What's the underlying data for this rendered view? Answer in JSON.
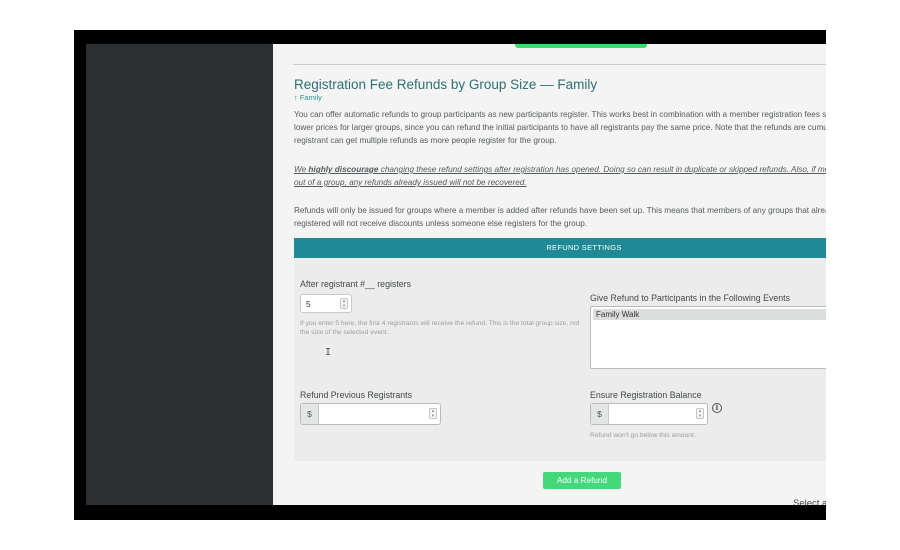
{
  "page": {
    "title": "Registration Fee Refunds by Group Size — Family",
    "breadcrumb": "↑ Family"
  },
  "intro": {
    "paragraph_1": "You can offer automatic refunds to group participants as new participants register. This works best in combination with a member registration fees set up with lower prices for larger groups, since you can refund the initial participants to have all registrants pay the same price. Note that the refunds are cumulative, so a registrant can get multiple refunds as more people register for the group.",
    "warning_prefix": "We ",
    "warning_bold": "highly discourage",
    "warning_rest": " changing these refund settings after registration has opened. Doing so can result in duplicate or skipped refunds. Also, if members drop out of a group, any refunds already issued will not be recovered.",
    "paragraph_3": "Refunds will only be issued for groups where a member is added after refunds have been set up. This means that members of any groups that already registered will not receive discounts unless someone else registers for the group."
  },
  "refund_settings": {
    "header": "REFUND SETTINGS",
    "close_icon": "×",
    "after_registrant_label": "After registrant #__ registers",
    "after_registrant_value": "5",
    "after_registrant_hint": "If you enter 5 here, the first 4 registrants will receive the refund. This is the total group size, not the size of the selected event.",
    "events_label": "Give Refund to Participants in the Following Events",
    "events_options": [
      "Family Walk"
    ],
    "refund_previous_label": "Refund Previous Registrants",
    "refund_previous_prefix": "$",
    "refund_previous_value": "",
    "ensure_balance_label": "Ensure Registration Balance",
    "ensure_balance_prefix": "$",
    "ensure_balance_value": "",
    "ensure_balance_hint": "Refund won't go below this amount.",
    "info_icon": "i"
  },
  "actions": {
    "add_refund_label": "Add a Refund"
  },
  "overflow": {
    "select_group_type": "Select a Group Type"
  },
  "colors": {
    "accent_teal": "#1f8a96",
    "title_teal": "#2f6f75",
    "button_green": "#43d97a",
    "sidebar_dark": "#2b2f31"
  },
  "icons": {
    "close": "close-icon",
    "info": "info-icon",
    "spinner": "spinner-arrows-icon",
    "text_cursor": "text-cursor-icon"
  }
}
